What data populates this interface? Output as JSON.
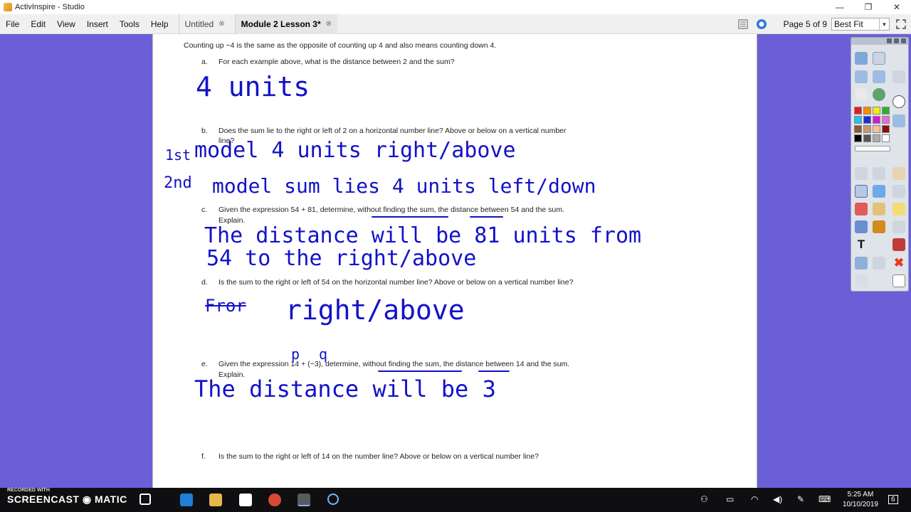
{
  "window": {
    "title": "ActivInspire - Studio"
  },
  "menu": [
    "File",
    "Edit",
    "View",
    "Insert",
    "Tools",
    "Help"
  ],
  "tabs": [
    {
      "label": "Untitled",
      "close": "⊗"
    },
    {
      "label": "Module 2 Lesson 3*",
      "close": "⊗"
    }
  ],
  "page_indicator": "Page 5 of 9",
  "zoom": "Best Fit",
  "doc": {
    "intro": "Counting up −4 is the same as the opposite of counting up 4 and also means counting down 4.",
    "q_a_letter": "a.",
    "q_a": "For each example above, what is the distance between 2 and the sum?",
    "q_b_letter": "b.",
    "q_b_line1": "Does the sum lie to the right or left of 2 on a horizontal number line?  Above or below on a vertical number",
    "q_b_line2": "line?",
    "q_c_letter": "c.",
    "q_c_line1": "Given the expression 54 + 81, determine, without finding the sum, the distance between 54 and the sum.",
    "q_c_line2": "Explain.",
    "q_d_letter": "d.",
    "q_d": "Is the sum to the right or left of 54 on the horizontal number line?  Above or below on a vertical number line?",
    "q_e_letter": "e.",
    "q_e_line1": "Given the expression 14 + (−3), determine, without finding the sum, the distance between 14 and the sum.",
    "q_e_line2": "Explain.",
    "q_f_letter": "f.",
    "q_f": "Is the sum to the right or left of 14 on the number line?  Above or below on a vertical number line?"
  },
  "ink": {
    "a_answer": "4 units",
    "b_first_label": "1st",
    "b_first": "model 4 units right/above",
    "b_second_label": "2nd",
    "b_second": "model sum lies 4 units left/down",
    "c_line1": "The distance will be 81 units from",
    "c_line2": "54 to the right/above",
    "d_struck": "Fror",
    "d_answer": "right/above",
    "e_p": "p",
    "e_q": "q",
    "e_answer": "The distance will be 3"
  },
  "taskbar": {
    "recorded": "RECORDED WITH",
    "brand": "SCREENCAST ◉ MATIC",
    "time": "5:25 AM",
    "date": "10/10/2019",
    "notif_count": "6"
  },
  "colors": {
    "ink": "#1212c8",
    "background": "#6a5fd6"
  }
}
